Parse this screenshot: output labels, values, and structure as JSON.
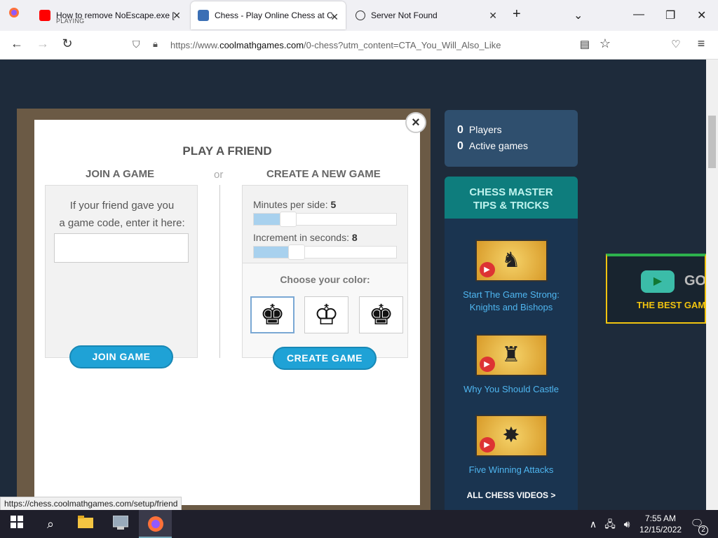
{
  "browser": {
    "tabs": [
      {
        "title": "How to remove NoEscape.exe [",
        "subtitle": "PLAYING",
        "favicon": "youtube-icon"
      },
      {
        "title": "Chess - Play Online Chess at Co",
        "favicon": "coolmath-icon"
      },
      {
        "title": "Server Not Found",
        "favicon": "info-icon"
      }
    ],
    "new_tab": "+",
    "url_prefix": "https://www.",
    "url_domain": "coolmathgames.com",
    "url_rest": "/0-chess?utm_content=CTA_You_Will_Also_Like"
  },
  "modal": {
    "title": "PLAY A FRIEND",
    "close": "×",
    "join": {
      "heading": "JOIN A GAME",
      "help_line1": "If your friend gave you",
      "help_line2": "a game code, enter it here:",
      "input_value": "",
      "button": "JOIN GAME"
    },
    "or": "or",
    "create": {
      "heading": "CREATE A NEW GAME",
      "minutes_label": "Minutes per side:",
      "minutes_value": "5",
      "minutes_fraction": 0.24,
      "increment_label": "Increment in seconds:",
      "increment_value": "8",
      "increment_fraction": 0.3,
      "choose_color": "Choose your color:",
      "colors": [
        "♚",
        "♔",
        "♚"
      ],
      "button": "CREATE GAME"
    }
  },
  "sidebar": {
    "players_count": "0",
    "players_label": "Players",
    "games_count": "0",
    "games_label": "Active games",
    "tips_title_1": "CHESS MASTER",
    "tips_title_2": "TIPS & TRICKS",
    "videos": [
      {
        "title_1": "Start The Game Strong:",
        "title_2": "Knights and Bishops",
        "icon": "knight-icon"
      },
      {
        "title_1": "Why You Should Castle",
        "title_2": "",
        "icon": "castle-icon"
      },
      {
        "title_1": "Five Winning Attacks",
        "title_2": "",
        "icon": "explosion-icon"
      }
    ],
    "all_videos": "ALL CHESS VIDEOS >"
  },
  "ad": {
    "go": "GO",
    "tagline": "THE BEST GAM"
  },
  "status_url": "https://chess.coolmathgames.com/setup/friend",
  "taskbar": {
    "time": "7:55 AM",
    "date": "12/15/2022",
    "notifications": "2"
  }
}
